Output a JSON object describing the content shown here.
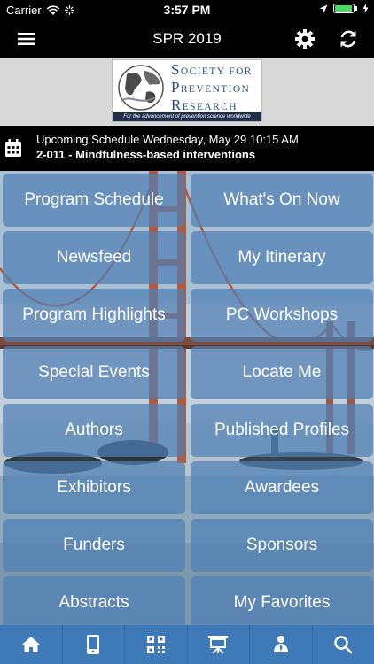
{
  "status_bar": {
    "carrier": "Carrier",
    "time": "3:57 PM",
    "battery_level": 0.95
  },
  "nav": {
    "title": "SPR 2019",
    "menu_icon": "hamburger-icon",
    "settings_icon": "gear-icon",
    "refresh_icon": "refresh-icon"
  },
  "logo": {
    "line1_initial": "S",
    "line1_rest": "OCIETY FOR",
    "line2_initial": "P",
    "line2_rest": "REVENTION",
    "line3_initial": "R",
    "line3_rest": "ESEARCH",
    "tagline": "For the advancement of prevention science worldwide"
  },
  "schedule": {
    "label": "Upcoming Schedule Wednesday, May 29 10:15 AM",
    "session": "2-011 - Mindfulness-based interventions"
  },
  "menu": {
    "items": [
      "Program Schedule",
      "What's On Now",
      "Newsfeed",
      "My Itinerary",
      "Program Highlights",
      "PC Workshops",
      "Special Events",
      "Locate Me",
      "Authors",
      "Published Profiles",
      "Exhibitors",
      "Awardees",
      "Funders",
      "Sponsors",
      "Abstracts",
      "My Favorites"
    ]
  },
  "tab_bar": {
    "icons": [
      "home-icon",
      "mobile-icon",
      "qr-code-icon",
      "presentation-icon",
      "attendee-icon",
      "search-icon"
    ]
  }
}
